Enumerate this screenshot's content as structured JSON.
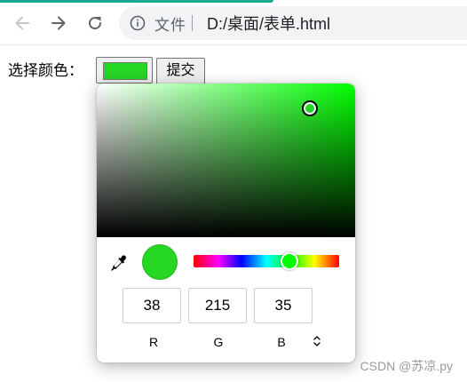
{
  "browser": {
    "file_label": "文件",
    "url": "D:/桌面/表单.html",
    "accent_color": "#1aa88f"
  },
  "icons": {
    "back": "arrow-left",
    "forward": "arrow-right",
    "reload": "reload",
    "info": "info-circle",
    "eyedropper": "eyedropper",
    "mode_toggle": "up-down-chevrons"
  },
  "form": {
    "color_label": "选择颜色：",
    "submit_label": "提交",
    "selected_color": "#26d723"
  },
  "picker": {
    "rgb": {
      "r": "38",
      "g": "215",
      "b": "35"
    },
    "labels": {
      "r": "R",
      "g": "G",
      "b": "B"
    },
    "hue_color": "#00ff00",
    "hue_fraction": 0.655
  },
  "watermark": "CSDN @苏凉.py"
}
